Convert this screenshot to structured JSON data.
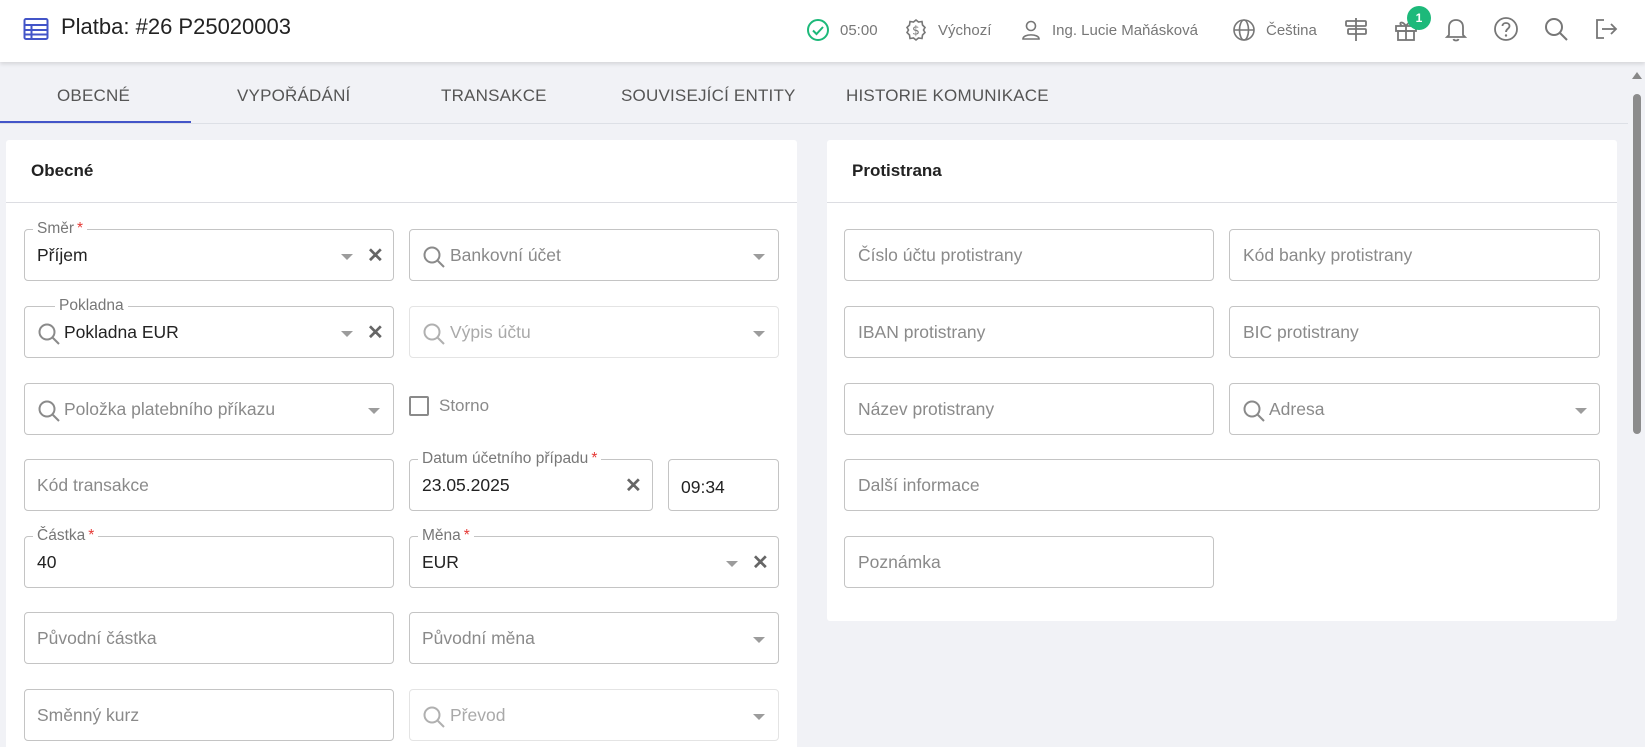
{
  "header": {
    "title": "Platba: #26 P25020003",
    "timer": "05:00",
    "currency_profile": "Výchozí",
    "user": "Ing. Lucie Maňásková",
    "language": "Čeština",
    "gift_badge": "1",
    "icons": [
      "table-icon",
      "check-circle-icon",
      "dollar-icon",
      "user-icon",
      "globe-icon",
      "signpost-icon",
      "gift-icon",
      "bell-icon",
      "help-icon",
      "search-icon",
      "logout-icon"
    ]
  },
  "tabs": [
    {
      "label": "OBECNÉ",
      "active": true
    },
    {
      "label": "VYPOŘÁDÁNÍ"
    },
    {
      "label": "TRANSAKCE"
    },
    {
      "label": "SOUVISEJÍCÍ ENTITY"
    },
    {
      "label": "HISTORIE KOMUNIKACE"
    }
  ],
  "obecne": {
    "title": "Obecné",
    "smer": {
      "label": "Směr",
      "value": "Příjem"
    },
    "bankovni_ucet": {
      "placeholder": "Bankovní účet"
    },
    "pokladna": {
      "label": "Pokladna",
      "value": "Pokladna EUR"
    },
    "vypis_uctu": {
      "placeholder": "Výpis účtu"
    },
    "polozka": {
      "placeholder": "Položka platebního příkazu"
    },
    "storno": {
      "label": "Storno",
      "checked": false
    },
    "kod_transakce": {
      "placeholder": "Kód transakce"
    },
    "datum": {
      "label": "Datum účetního případu",
      "value": "23.05.2025"
    },
    "cas": {
      "value": "09:34"
    },
    "castka": {
      "label": "Částka",
      "value": "40"
    },
    "mena": {
      "label": "Měna",
      "value": "EUR"
    },
    "puvodni_castka": {
      "placeholder": "Původní částka"
    },
    "puvodni_mena": {
      "placeholder": "Původní měna"
    },
    "smenny_kurz": {
      "placeholder": "Směnný kurz"
    },
    "prevod": {
      "placeholder": "Převod"
    }
  },
  "protistrana": {
    "title": "Protistrana",
    "cislo_uctu": {
      "placeholder": "Číslo účtu protistrany"
    },
    "kod_banky": {
      "placeholder": "Kód banky protistrany"
    },
    "iban": {
      "placeholder": "IBAN protistrany"
    },
    "bic": {
      "placeholder": "BIC protistrany"
    },
    "nazev": {
      "placeholder": "Název protistrany"
    },
    "adresa": {
      "placeholder": "Adresa"
    },
    "dalsi_informace": {
      "placeholder": "Další informace"
    },
    "poznamka": {
      "placeholder": "Poznámka"
    }
  },
  "required_mark": "*",
  "clear_glyph": "✕",
  "colors": {
    "accent": "#4355c8",
    "required": "#e53935",
    "success": "#1db97a"
  }
}
